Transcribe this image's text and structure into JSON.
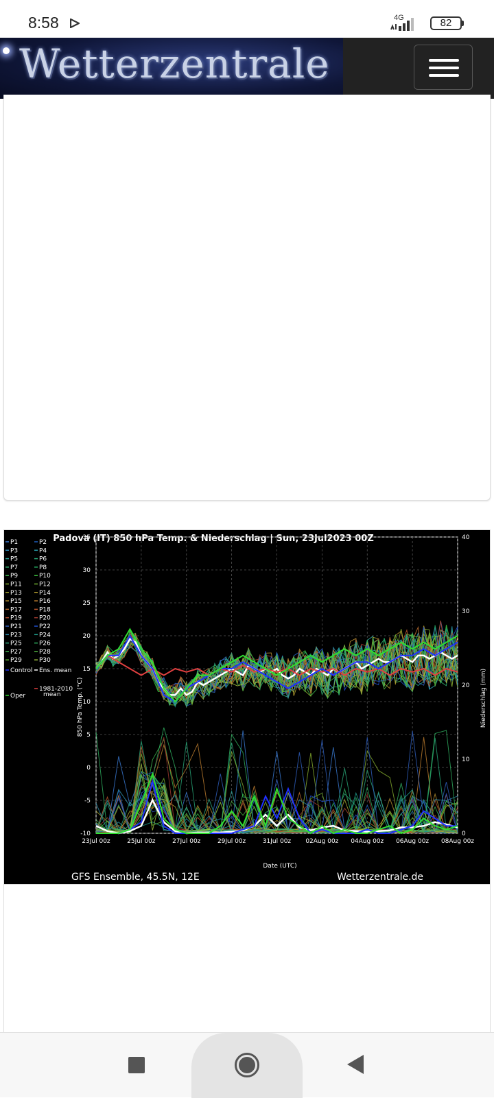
{
  "status_bar": {
    "time": "8:58",
    "network": "4G",
    "battery": "82"
  },
  "header": {
    "logo_text": "Wetterzentrale"
  },
  "chart_data": {
    "type": "line",
    "title": "Padova  (IT)  850 hPa Temp. & Niederschlag | Sun, 23Jul2023 00Z",
    "xlabel": "Date (UTC)",
    "ylabel": "850 hPa Temp. (°C)",
    "y2label": "Niederschlag (mm)",
    "footer_left": "GFS Ensemble, 45.5N, 12E",
    "footer_right": "Wetterzentrale.de",
    "x_tick_labels": [
      "23Jul 00z",
      "25Jul 00z",
      "27Jul 00z",
      "29Jul 00z",
      "31Jul 00z",
      "02Aug 00z",
      "04Aug 00z",
      "06Aug 00z",
      "08Aug 00z"
    ],
    "ylim": [
      -10,
      35
    ],
    "y_ticks": [
      35,
      30,
      25,
      20,
      15,
      10,
      5,
      0,
      -5,
      -10
    ],
    "y2lim": [
      0,
      40
    ],
    "y2_ticks": [
      40,
      30,
      20,
      10,
      0
    ],
    "grid": true,
    "legend_placement": "left",
    "legend": [
      {
        "label": "P1",
        "color": "#3a7bd5"
      },
      {
        "label": "P2",
        "color": "#1f5fbf"
      },
      {
        "label": "P3",
        "color": "#2f8fc0"
      },
      {
        "label": "P4",
        "color": "#2aa0b0"
      },
      {
        "label": "P5",
        "color": "#2fa8a0"
      },
      {
        "label": "P6",
        "color": "#28a878"
      },
      {
        "label": "P7",
        "color": "#30b070"
      },
      {
        "label": "P8",
        "color": "#25a860"
      },
      {
        "label": "P9",
        "color": "#40b850"
      },
      {
        "label": "P10",
        "color": "#3cc040"
      },
      {
        "label": "P11",
        "color": "#88b030"
      },
      {
        "label": "P12",
        "color": "#70b030"
      },
      {
        "label": "P13",
        "color": "#a8a830"
      },
      {
        "label": "P14",
        "color": "#b8a030"
      },
      {
        "label": "P15",
        "color": "#b89030"
      },
      {
        "label": "P16",
        "color": "#c08030"
      },
      {
        "label": "P17",
        "color": "#c07030"
      },
      {
        "label": "P18",
        "color": "#c05a30"
      },
      {
        "label": "P19",
        "color": "#b04a30"
      },
      {
        "label": "P20",
        "color": "#a03c30"
      },
      {
        "label": "P21",
        "color": "#3060c0"
      },
      {
        "label": "P22",
        "color": "#2050d0"
      },
      {
        "label": "P23",
        "color": "#3090b0"
      },
      {
        "label": "P24",
        "color": "#20a090"
      },
      {
        "label": "P25",
        "color": "#30a880"
      },
      {
        "label": "P26",
        "color": "#30b060"
      },
      {
        "label": "P27",
        "color": "#40b050"
      },
      {
        "label": "P28",
        "color": "#50b040"
      },
      {
        "label": "P29",
        "color": "#60b838"
      },
      {
        "label": "P30",
        "color": "#a0c040"
      },
      {
        "label": "Control",
        "color": "#2030ff"
      },
      {
        "label": "Ens. mean",
        "color": "#ffffff"
      },
      {
        "label": "1981-2010 mean",
        "color": "#e04040"
      },
      {
        "label": "Oper",
        "color": "#30e030"
      }
    ],
    "series": [
      {
        "name": "Ens. mean",
        "axis": "temp",
        "color": "#ffffff",
        "x": [
          0,
          0.25,
          0.5,
          0.75,
          1,
          1.25,
          1.5,
          1.75,
          2,
          2.25,
          2.5,
          2.75,
          3,
          3.25,
          3.5,
          3.75,
          4,
          4.25,
          4.5,
          4.75,
          5,
          5.25,
          5.5,
          5.75,
          6,
          6.25,
          6.5,
          6.75,
          7,
          7.25,
          7.5,
          7.75,
          8,
          8.25,
          8.5,
          8.75,
          9,
          9.25,
          9.5,
          9.75,
          10,
          10.25,
          10.5,
          10.75,
          11,
          11.25,
          11.5,
          11.75,
          12,
          12.25,
          12.5,
          12.75,
          13,
          13.25,
          13.5,
          13.75,
          14,
          14.25,
          14.5,
          14.75,
          15,
          15.25,
          15.5,
          15.75,
          16
        ],
        "y": [
          15,
          16,
          17.5,
          16.5,
          17,
          18,
          19.5,
          19,
          17,
          16,
          15,
          13,
          12,
          11,
          11,
          12,
          11,
          11.5,
          13,
          12.5,
          13,
          13.5,
          14,
          14.5,
          15,
          14.5,
          14,
          15.5,
          15,
          14.5,
          15,
          14.5,
          15,
          14,
          13.5,
          14,
          15,
          14.5,
          14,
          15,
          14.5,
          14,
          15,
          14.5,
          15,
          15.5,
          16,
          15,
          15.5,
          16,
          16.5,
          16,
          16,
          16.5,
          17,
          16.5,
          16,
          17,
          17,
          16.5,
          17,
          17.5,
          17,
          16.5,
          17
        ]
      },
      {
        "name": "1981-2010 mean",
        "axis": "temp",
        "color": "#e04040",
        "x": [
          0,
          0.5,
          1,
          1.5,
          2,
          2.5,
          3,
          3.5,
          4,
          4.5,
          5,
          5.5,
          6,
          6.5,
          7,
          7.5,
          8,
          8.5,
          9,
          9.5,
          10,
          10.5,
          11,
          11.5,
          12,
          12.5,
          13,
          13.5,
          14,
          14.5,
          15,
          15.5,
          16
        ],
        "y": [
          15,
          17,
          16,
          15,
          14,
          15,
          14,
          15,
          14.5,
          15,
          14,
          15,
          14.5,
          15.5,
          14.5,
          15,
          14.5,
          15,
          14,
          15,
          14.5,
          15,
          14,
          15,
          14.5,
          15,
          14,
          15,
          14.5,
          15,
          14,
          15,
          14.5
        ]
      },
      {
        "name": "Control",
        "axis": "temp",
        "color": "#2030ff",
        "x": [
          0,
          0.5,
          1,
          1.5,
          2,
          2.5,
          3,
          3.5,
          4,
          4.5,
          5,
          5.5,
          6,
          6.5,
          7,
          7.5,
          8,
          8.5,
          9,
          9.5,
          10,
          10.5,
          11,
          11.5,
          12,
          12.5,
          13,
          13.5,
          14,
          14.5,
          15,
          15.5,
          16
        ],
        "y": [
          15,
          17,
          17,
          20,
          17,
          15,
          11,
          10,
          12,
          13,
          14,
          15,
          15,
          16,
          15,
          14,
          13,
          12,
          13,
          14,
          15,
          14,
          15,
          16,
          16,
          15,
          16,
          17,
          17,
          18,
          17,
          18,
          19
        ]
      },
      {
        "name": "Oper",
        "axis": "temp",
        "color": "#30e030",
        "x": [
          0,
          0.5,
          1,
          1.5,
          2,
          2.5,
          3,
          3.5,
          4,
          4.5,
          5,
          5.5,
          6,
          6.5,
          7,
          7.5,
          8,
          8.5,
          9,
          9.5,
          10,
          10.5,
          11,
          11.5,
          12,
          12.5,
          13,
          13.5,
          14,
          14.5,
          15,
          15.5,
          16
        ],
        "y": [
          15,
          17,
          18,
          21,
          18,
          16,
          12,
          10,
          12,
          14,
          14,
          15,
          16,
          17,
          16,
          15,
          14,
          15,
          16,
          17,
          16,
          17,
          18,
          17,
          18,
          17,
          18,
          19,
          18,
          19,
          18,
          19,
          20
        ]
      },
      {
        "name": "Ens. mean",
        "axis": "precip",
        "color": "#ffffff",
        "x": [
          0,
          0.5,
          1,
          1.5,
          2,
          2.5,
          3,
          3.5,
          4,
          4.5,
          5,
          5.5,
          6,
          6.5,
          7,
          7.5,
          8,
          8.5,
          9,
          9.5,
          10,
          10.5,
          11,
          11.5,
          12,
          12.5,
          13,
          13.5,
          14,
          14.5,
          15,
          15.5,
          16
        ],
        "y": [
          1,
          0.3,
          0,
          0.3,
          1,
          4.5,
          1.5,
          0.3,
          0,
          0.1,
          0.1,
          0.1,
          0.2,
          0.4,
          1,
          2.5,
          1,
          2.5,
          0.8,
          0.4,
          0.8,
          1,
          0.4,
          0.3,
          0.2,
          0.3,
          0.4,
          0.8,
          0.8,
          1,
          1.5,
          1.2,
          0.8
        ]
      },
      {
        "name": "Control",
        "axis": "precip",
        "color": "#2030ff",
        "x": [
          0,
          0.5,
          1,
          1.5,
          2,
          2.5,
          3,
          3.5,
          4,
          4.5,
          5,
          5.5,
          6,
          6.5,
          7,
          7.5,
          8,
          8.5,
          9,
          9.5,
          10,
          10.5,
          11,
          11.5,
          12,
          12.5,
          13,
          13.5,
          14,
          14.5,
          15,
          15.5,
          16
        ],
        "y": [
          0,
          0,
          0,
          0.5,
          1.5,
          7,
          1,
          0,
          0,
          0,
          0,
          0,
          0,
          0.5,
          1,
          5,
          2,
          6,
          2,
          0,
          0.5,
          0,
          0,
          0,
          0.5,
          0,
          0,
          0.5,
          1,
          3,
          2,
          1,
          1
        ]
      },
      {
        "name": "Oper",
        "axis": "precip",
        "color": "#30e030",
        "x": [
          0,
          0.5,
          1,
          1.5,
          2,
          2.5,
          3,
          3.5,
          4,
          4.5,
          5,
          5.5,
          6,
          6.5,
          7,
          7.5,
          8,
          8.5,
          9,
          9.5,
          10,
          10.5,
          11,
          11.5,
          12,
          12.5,
          13,
          13.5,
          14,
          14.5,
          15,
          15.5,
          16
        ],
        "y": [
          0,
          0,
          0,
          0.5,
          4,
          8,
          2,
          0.5,
          0,
          0,
          0,
          1,
          3,
          1,
          5,
          1,
          6,
          2,
          1,
          0,
          1,
          0,
          0.5,
          0,
          0,
          0.5,
          1,
          0,
          0.5,
          2,
          1,
          0.5,
          1
        ]
      }
    ]
  }
}
